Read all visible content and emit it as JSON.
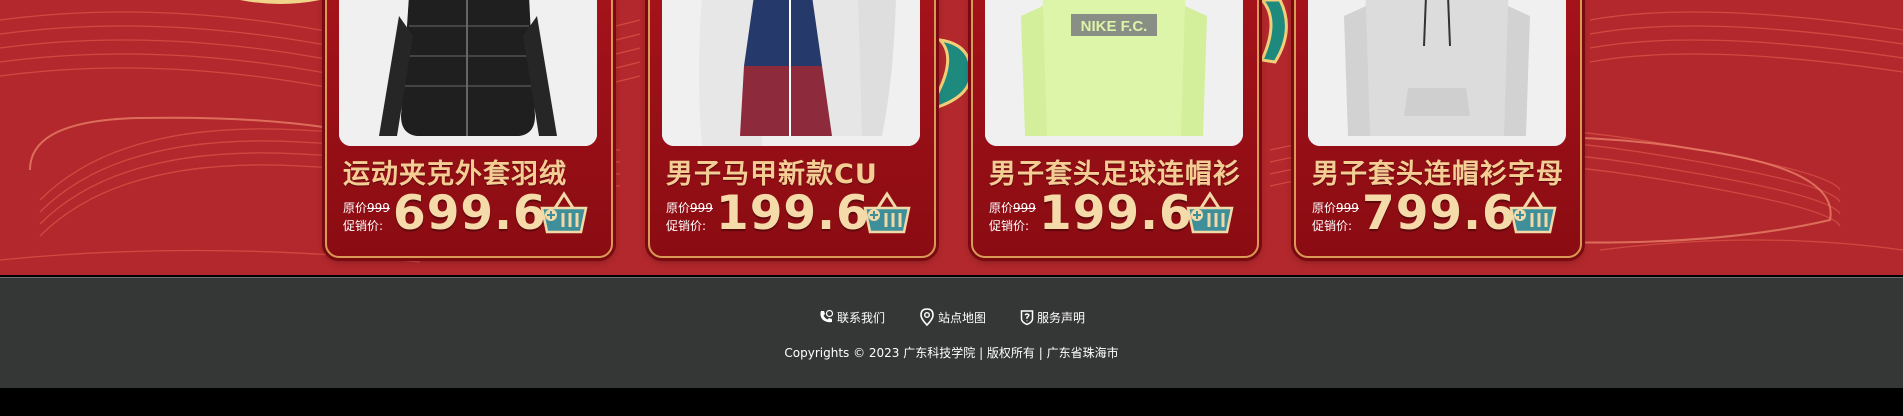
{
  "products": [
    {
      "name": "运动夹克外套羽绒",
      "original_label": "原价",
      "original_price": "999",
      "promo_label": "促销价:",
      "price": "699.6"
    },
    {
      "name": "男子马甲新款CU",
      "original_label": "原价",
      "original_price": "999",
      "promo_label": "促销价:",
      "price": "199.6"
    },
    {
      "name": "男子套头足球连帽衫",
      "original_label": "原价",
      "original_price": "999",
      "promo_label": "促销价:",
      "price": "199.6",
      "logo_text": "NIKE F.C."
    },
    {
      "name": "男子套头连帽衫字母",
      "original_label": "原价",
      "original_price": "999",
      "promo_label": "促销价:",
      "price": "799.6"
    }
  ],
  "footer": {
    "links": [
      {
        "label": "联系我们",
        "icon": "phone-icon"
      },
      {
        "label": "站点地图",
        "icon": "map-pin-icon"
      },
      {
        "label": "服务声明",
        "icon": "shield-icon"
      }
    ],
    "copyright": "Copyrights © 2023 广东科技学院 | 版权所有 | 广东省珠海市"
  },
  "colors": {
    "banner_red": "#b3282c",
    "card_red": "#a5121a",
    "card_border": "#d99a58",
    "gold_text": "#f4cd95",
    "footer_bg": "#353636",
    "cart_teal": "#3f8f9a"
  }
}
